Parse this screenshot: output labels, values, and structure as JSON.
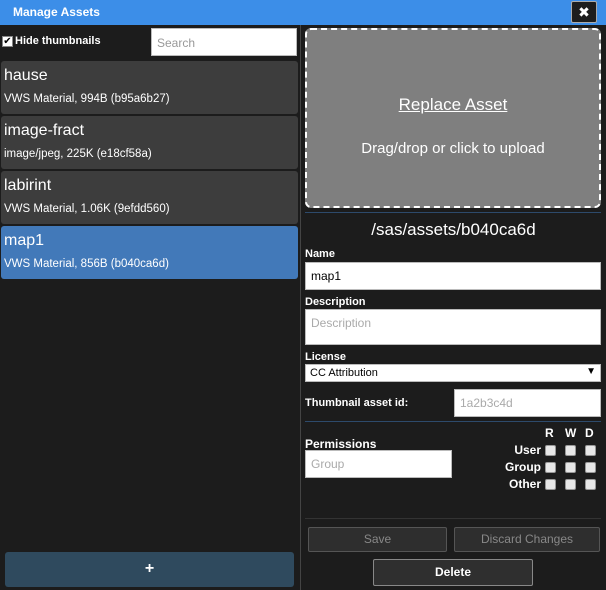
{
  "window": {
    "title": "Manage Assets",
    "close_label": "✖"
  },
  "sidebar": {
    "hide_thumbnails_label": "Hide thumbnails",
    "hide_thumbnails_checked": "✔",
    "search_placeholder": "Search",
    "assets": [
      {
        "name": "hause",
        "meta": "VWS Material, 994B (b95a6b27)"
      },
      {
        "name": "image-fract",
        "meta": "image/jpeg, 225K (e18cf58a)"
      },
      {
        "name": "labirint",
        "meta": "VWS Material, 1.06K (9efdd560)"
      },
      {
        "name": "map1",
        "meta": "VWS Material, 856B (b040ca6d)"
      }
    ],
    "add_label": "+"
  },
  "detail": {
    "replace_label": "Replace Asset",
    "drop_hint": "Drag/drop or click to upload",
    "path": "/sas/assets/b040ca6d",
    "name_label": "Name",
    "name_value": "map1",
    "description_label": "Description",
    "description_placeholder": "Description",
    "license_label": "License",
    "license_value": "CC Attribution",
    "thumbnail_label": "Thumbnail asset id:",
    "thumbnail_placeholder": "1a2b3c4d",
    "permissions_label": "Permissions",
    "group_placeholder": "Group",
    "perm_cols": [
      "R",
      "W",
      "D"
    ],
    "perm_rows": [
      "User",
      "Group",
      "Other"
    ],
    "save_label": "Save",
    "discard_label": "Discard Changes",
    "delete_label": "Delete"
  }
}
